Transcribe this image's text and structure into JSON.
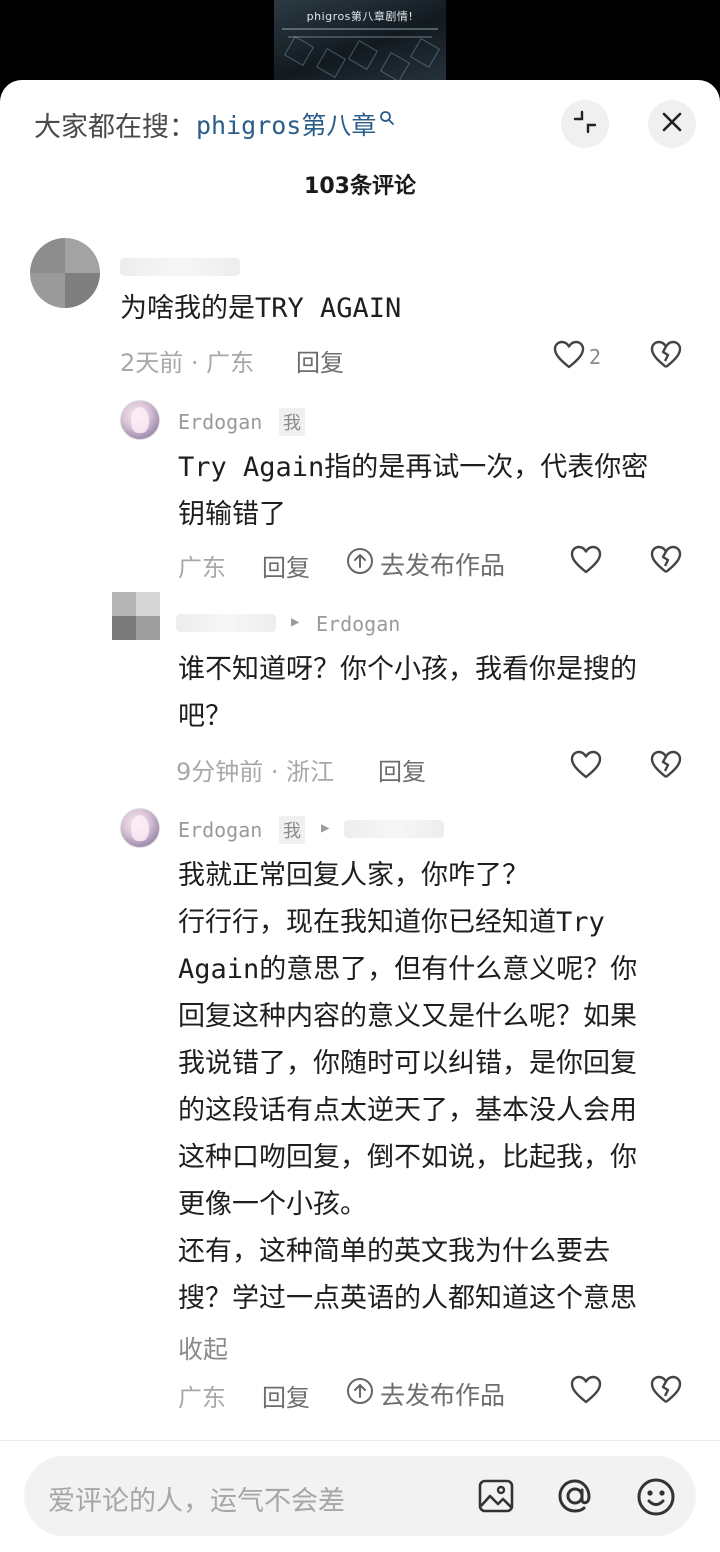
{
  "video": {
    "title": "phigros第八章剧情!"
  },
  "header": {
    "search_prefix": "大家都在搜：",
    "search_term": "phigros第八章",
    "comment_count": "103条评论"
  },
  "comments": [
    {
      "text": "为啥我的是TRY AGAIN",
      "meta": "2天前 · 广东",
      "reply": "回复",
      "likes": "2"
    },
    {
      "username": "Erdogan",
      "badge": "我",
      "text": "Try Again指的是再试一次，代表你密\n钥输错了",
      "meta": "广东",
      "reply": "回复",
      "publish": "去发布作品"
    },
    {
      "reply_to": "Erdogan",
      "text": "谁不知道呀？你个小孩，我看你是搜的\n吧？",
      "meta": "9分钟前 · 浙江",
      "reply": "回复"
    },
    {
      "username": "Erdogan",
      "badge": "我",
      "text": "我就正常回复人家，你咋了？\n行行行，现在我知道你已经知道Try\nAgain的意思了，但有什么意义呢？你\n回复这种内容的意义又是什么呢？如果\n我说错了，你随时可以纠错，是你回复\n的这段话有点太逆天了，基本没人会用\n这种口吻回复，倒不如说，比起我，你\n更像一个小孩。\n还有，这种简单的英文我为什么要去\n搜？学过一点英语的人都知道这个意思",
      "collapse": "收起",
      "meta": "广东",
      "reply": "回复",
      "publish": "去发布作品"
    }
  ],
  "input": {
    "placeholder": "爱评论的人，运气不会差"
  },
  "icons": [
    "search-icon",
    "collapse-icon",
    "close-icon",
    "heart-icon",
    "broken-heart-icon",
    "publish-icon",
    "image-icon",
    "at-icon",
    "emoji-icon"
  ]
}
